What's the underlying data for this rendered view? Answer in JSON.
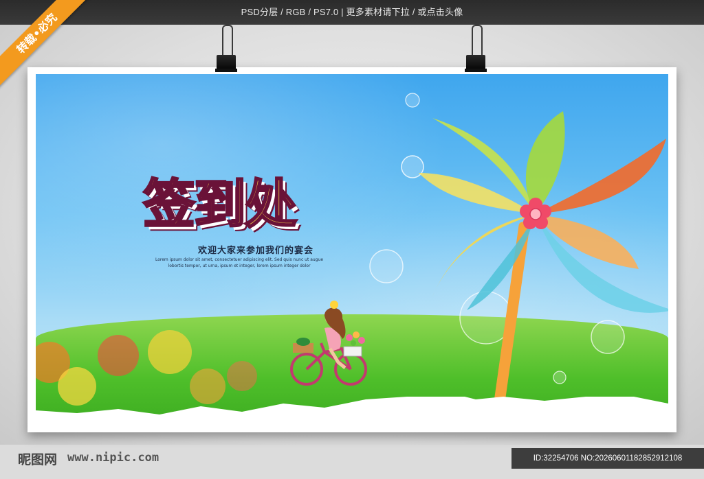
{
  "header": {
    "info_text": "PSD分层 / RGB / PS7.0 | 更多素材请下拉 / 或点击头像"
  },
  "ribbon": {
    "label": "转载•必究"
  },
  "poster": {
    "title": "签到处",
    "subtitle": "欢迎大家来参加我们的宴会",
    "body_lines": [
      "Lorem ipsum dolor sit amet, consectetuer adipiscing elit. Sed quis nunc ut augue",
      "lobortis tempor, ut urna, ipsum et integer, lorem ipsum integer dolor"
    ]
  },
  "footer": {
    "logo": "昵图网",
    "url": "www.nipic.com",
    "id_text": "ID:32254706 NO:20260601182852912108"
  },
  "colors": {
    "title_fill": "#ffe34a",
    "title_stroke": "#6a1238",
    "ribbon": "#f39a1e",
    "sky": "#3fa6ee",
    "grass": "#4fbf2a"
  }
}
